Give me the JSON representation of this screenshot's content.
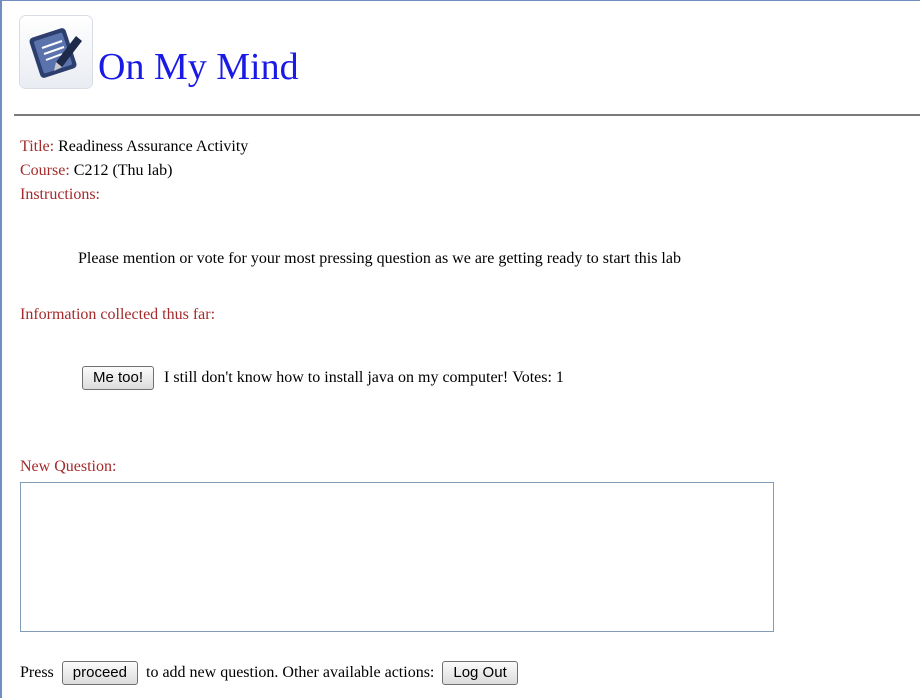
{
  "app": {
    "title": "On My Mind",
    "logo_icon": "pencil-notepad-icon",
    "title_color": "#1a1ae6"
  },
  "info": {
    "title_label": "Title:",
    "title_value": "Readiness Assurance Activity",
    "course_label": "Course:",
    "course_value": "C212 (Thu lab)",
    "instructions_label": "Instructions:",
    "instructions_text": "Please mention or vote for your most pressing question as we are getting ready to start this lab"
  },
  "collected": {
    "label": "Information collected thus far:",
    "items": [
      {
        "button_label": "Me too!",
        "text": "I still don't know how to install java on my computer!",
        "votes_text": "Votes: 1"
      }
    ]
  },
  "new_question": {
    "label": "New Question:",
    "value": ""
  },
  "footer": {
    "press_text": "Press",
    "proceed_label": "proceed",
    "middle_text": "to add new question. Other available actions:",
    "logout_label": "Log Out"
  },
  "colors": {
    "label": "#a52a2a",
    "rule": "#7a7a7a",
    "frame": "#6f8fbf"
  }
}
